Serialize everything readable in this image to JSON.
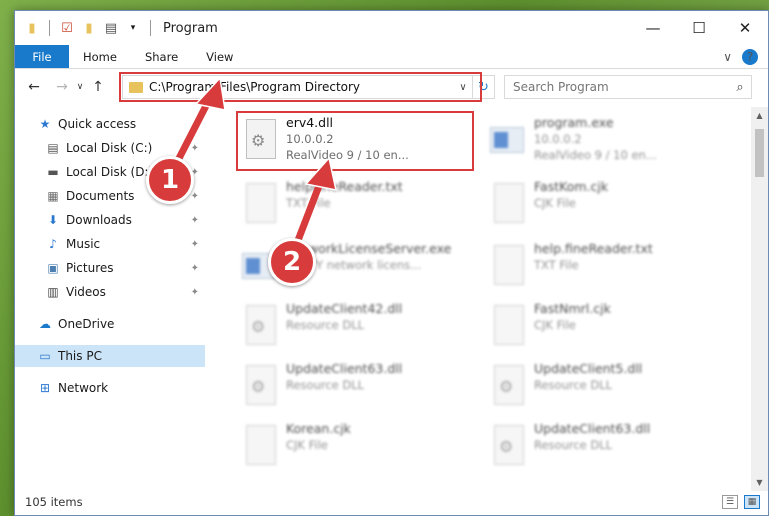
{
  "window": {
    "title": "Program",
    "controls": {
      "minimize": "—",
      "maximize": "☐",
      "close": "✕"
    }
  },
  "ribbon": {
    "tabs": [
      "File",
      "Home",
      "Share",
      "View"
    ],
    "collapse_glyph": "∨",
    "help_glyph": "?"
  },
  "nav": {
    "back": "←",
    "forward": "→",
    "recent": "∨",
    "up": "↑",
    "address": "C:\\Program Files\\Program Directory",
    "address_drop": "∨",
    "refresh": "↻",
    "search_placeholder": "Search Program",
    "search_glyph": "⌕"
  },
  "sidebar": {
    "items": [
      {
        "label": "Quick access",
        "icon": "★",
        "pinned": false
      },
      {
        "label": "Local Disk (C:)",
        "icon": "▤",
        "pinned": true
      },
      {
        "label": "Local Disk (D:)",
        "icon": "▬",
        "pinned": true
      },
      {
        "label": "Documents",
        "icon": "▦",
        "pinned": true
      },
      {
        "label": "Downloads",
        "icon": "⬇",
        "pinned": true
      },
      {
        "label": "Music",
        "icon": "♪",
        "pinned": true
      },
      {
        "label": "Pictures",
        "icon": "▣",
        "pinned": true
      },
      {
        "label": "Videos",
        "icon": "▥",
        "pinned": true
      },
      {
        "label": "OneDrive",
        "icon": "☁",
        "pinned": false
      },
      {
        "label": "This PC",
        "icon": "▭",
        "pinned": false,
        "selected": true
      },
      {
        "label": "Network",
        "icon": "⊞",
        "pinned": false
      }
    ],
    "pin_glyph": "✦"
  },
  "files": [
    {
      "name": "erv4.dll",
      "line2": "10.0.0.2",
      "line3": "RealVideo 9 / 10 en...",
      "kind": "dll",
      "highlight": true
    },
    {
      "name": "program.exe",
      "line2": "10.0.0.2",
      "line3": "RealVideo 9 / 10 en...",
      "kind": "exe"
    },
    {
      "name": "helpFineReader.txt",
      "line2": "TXT File",
      "kind": "doc"
    },
    {
      "name": "FastKom.cjk",
      "line2": "CJK File",
      "kind": "doc"
    },
    {
      "name": "NetworkLicenseServer.exe",
      "line2": "ABBYY network licens...",
      "kind": "exe"
    },
    {
      "name": "help.fineReader.txt",
      "line2": "TXT File",
      "kind": "doc"
    },
    {
      "name": "UpdateClient42.dll",
      "line2": "Resource DLL",
      "kind": "dll"
    },
    {
      "name": "FastNmrl.cjk",
      "line2": "CJK File",
      "kind": "doc"
    },
    {
      "name": "UpdateClient63.dll",
      "line2": "Resource DLL",
      "kind": "dll"
    },
    {
      "name": "UpdateClient5.dll",
      "line2": "Resource DLL",
      "kind": "dll"
    },
    {
      "name": "Korean.cjk",
      "line2": "CJK File",
      "kind": "doc"
    },
    {
      "name": "UpdateClient63.dll",
      "line2": "Resource DLL",
      "kind": "dll"
    }
  ],
  "status": {
    "items_count": "105 items"
  },
  "callouts": {
    "step1": "1",
    "step2": "2"
  },
  "colors": {
    "accent": "#1979ca",
    "highlight": "#d83b3b",
    "selected": "#cce4f7"
  }
}
